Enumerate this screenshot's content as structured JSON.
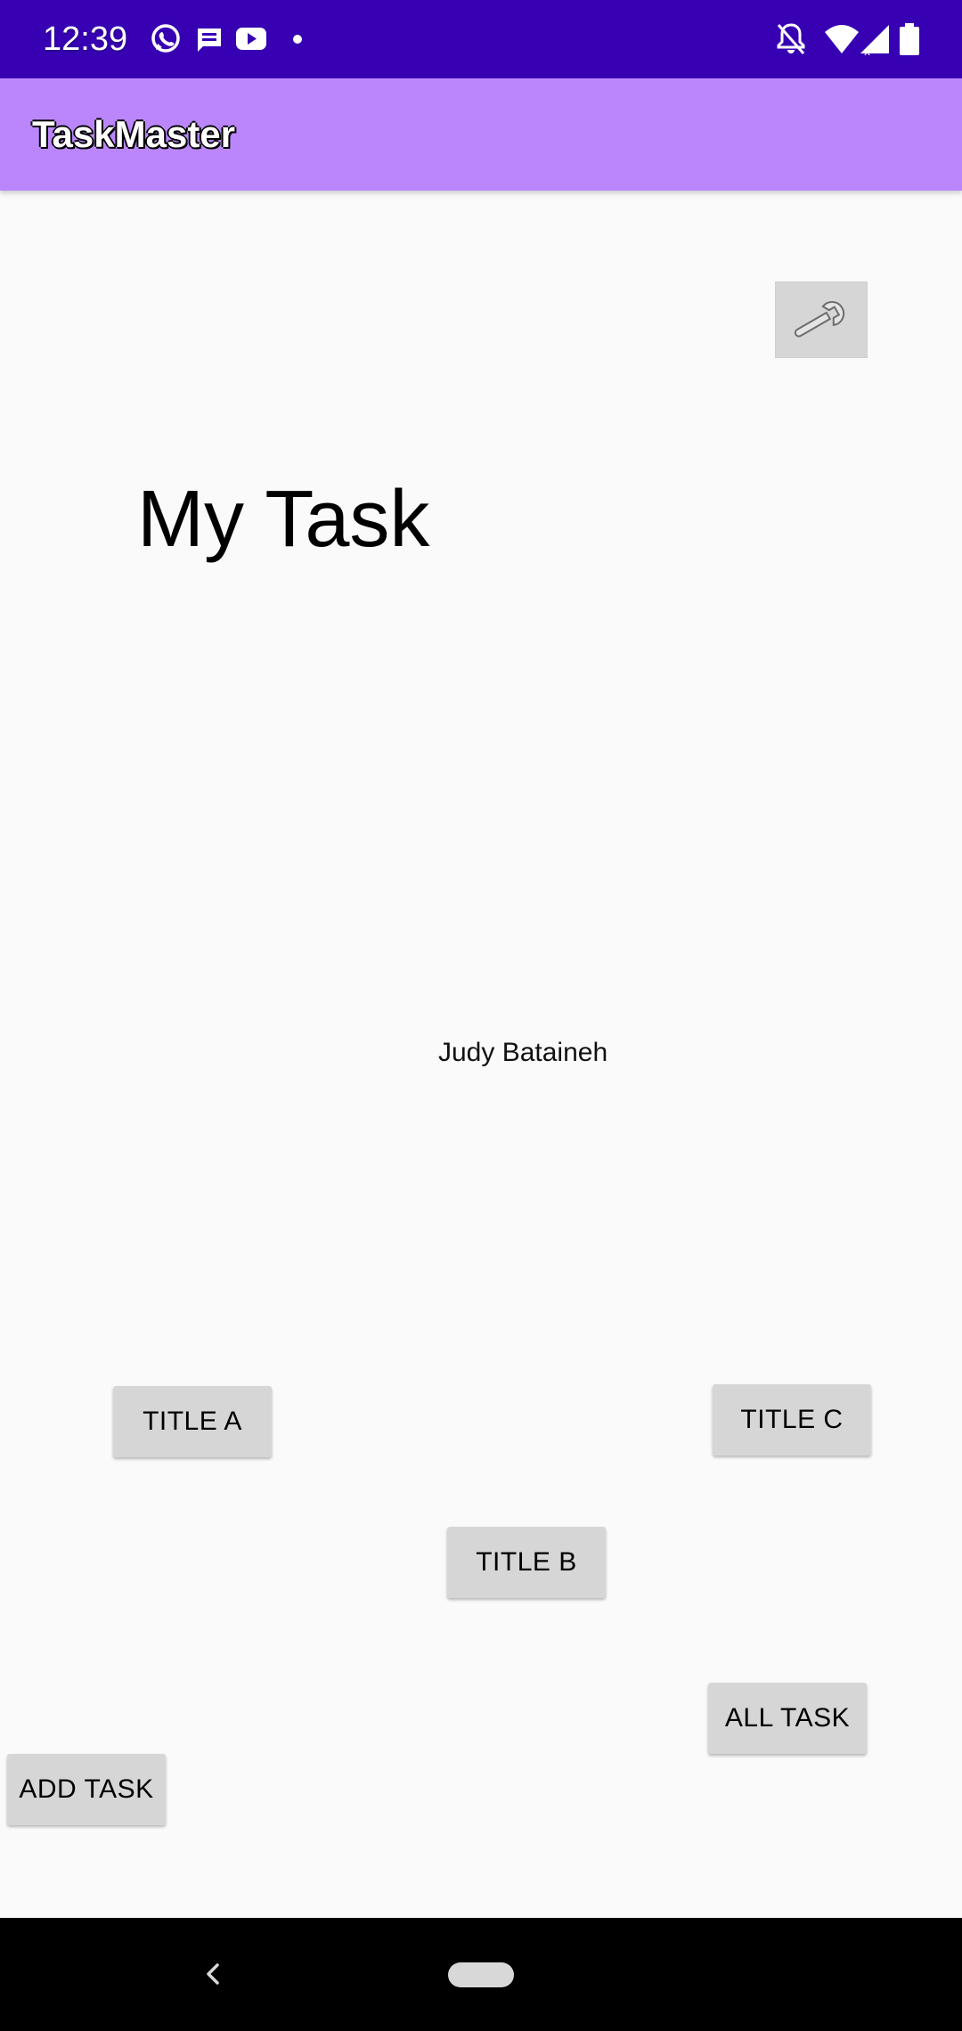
{
  "status_bar": {
    "time": "12:39",
    "left_icons": [
      "whatsapp-icon",
      "message-icon",
      "youtube-icon",
      "dot-icon"
    ],
    "right_icons": [
      "notifications-off-icon",
      "wifi-icon",
      "signal-icon",
      "battery-icon"
    ]
  },
  "app_bar": {
    "title": "TaskMaster"
  },
  "settings_button": {
    "icon": "wrench-icon"
  },
  "main": {
    "heading": "My Task",
    "user_name": "Judy Bataineh"
  },
  "buttons": {
    "title_a": "TITLE A",
    "title_b": "TITLE B",
    "title_c": "TITLE C",
    "all_task": "ALL TASK",
    "add_task": "ADD TASK"
  },
  "colors": {
    "status_bar": "#3700b3",
    "app_bar": "#bb86fc",
    "background": "#fafafa",
    "button": "#d6d6d6"
  }
}
